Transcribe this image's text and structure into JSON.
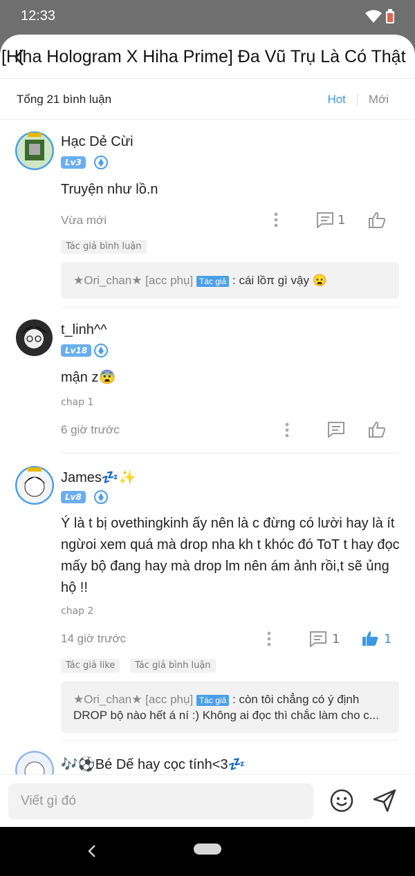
{
  "status": {
    "time": "12:33"
  },
  "header": {
    "title": "[Hiha Hologram X Hiha Prime] Đa Vũ Trụ Là Có Thật"
  },
  "summary": {
    "count_label": "Tổng 21 bình luận",
    "sort_hot": "Hot",
    "sort_new": "Mới",
    "active_sort": "Hot"
  },
  "colors": {
    "accent": "#3d97e6",
    "level_badge": "#6aaef0"
  },
  "comments": [
    {
      "name": "Hạc Dẻ Cừi",
      "level": "Lv3",
      "body": "Truyện như lồ.n",
      "time": "Vừa mới",
      "replies": "1",
      "likes": "",
      "tags": [
        "Tác giả bình luận"
      ],
      "reply": {
        "user": "★Ori_chan★ [acc phụ]",
        "author_badge": "Tác giả",
        "text": ": cái lồπ gì vậy 😦"
      }
    },
    {
      "name": "t_linh^^",
      "level": "Lv18",
      "body": "mận z😨",
      "chap": "chap 1",
      "time": "6 giờ trước"
    },
    {
      "name": "James💤✨",
      "level": "Lv8",
      "body": "Ý là t bị ovethingkinh ấy nên là c đừng có lười hay là ít ngừoi xem quá mà drop nha kh t khóc đó ToT t hay đọc mấy bộ đang hay mà drop lm nên ám ảnh rồi,t sẽ ủng hộ !!",
      "chap": "chap 2",
      "time": "14 giờ trước",
      "replies": "1",
      "likes": "1",
      "tags": [
        "Tác giả like",
        "Tác giả bình luận"
      ],
      "reply": {
        "user": "★Ori_chan★ [acc phụ]",
        "author_badge": "Tác giả",
        "text": ": còn tôi chẳng có ý định DROP bộ nào hết á ní :) Không ai đọc thì chắc làm cho c..."
      }
    },
    {
      "name": "🎶⚽Bé Dế hay cọc tính<3💤"
    }
  ],
  "composer": {
    "placeholder": "Viết gì đó"
  }
}
